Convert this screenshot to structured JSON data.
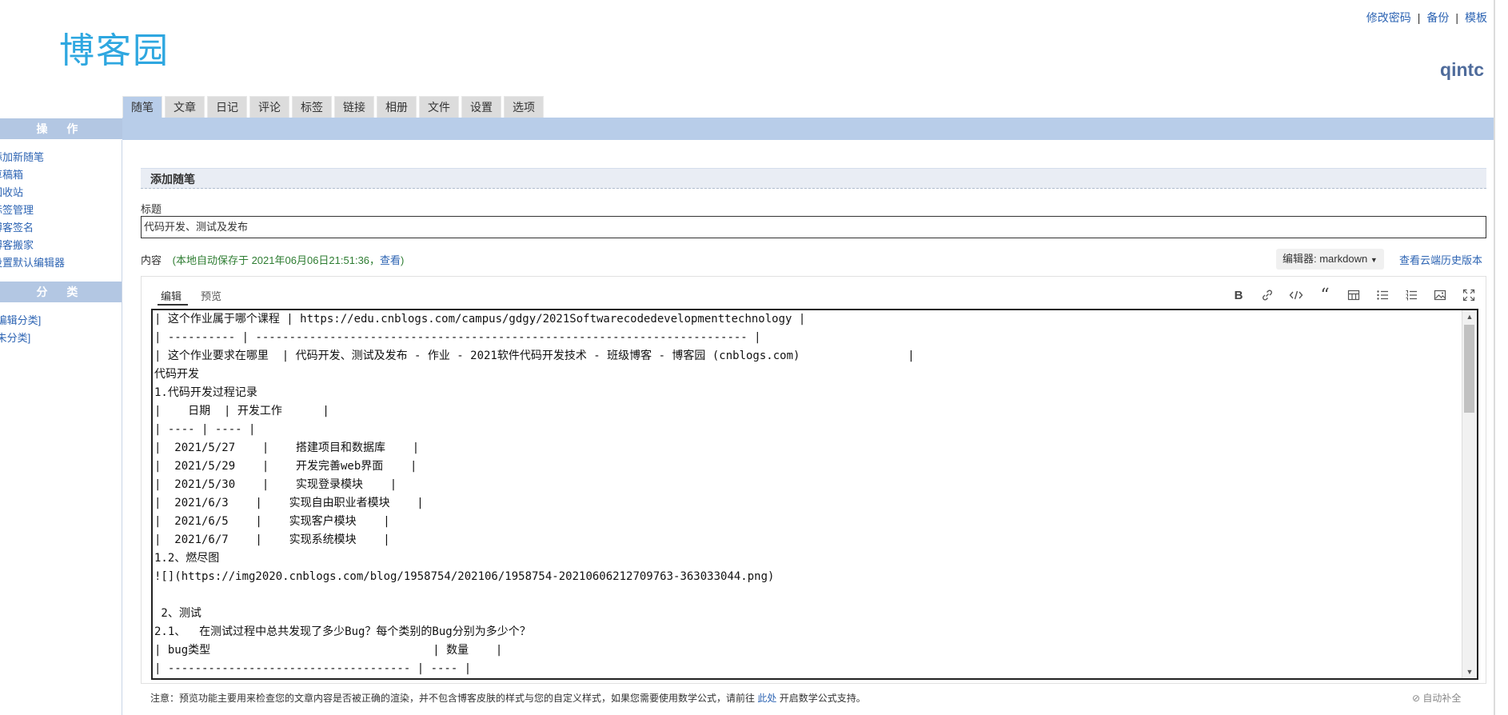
{
  "logo": {
    "text": "博客园"
  },
  "top_links": [
    "修改密码",
    "备份",
    "模板"
  ],
  "username": "qintc",
  "tabs": [
    "随笔",
    "文章",
    "日记",
    "评论",
    "标签",
    "链接",
    "相册",
    "文件",
    "设置",
    "选项"
  ],
  "sidebar": {
    "ops_title": "操 作",
    "ops_items": [
      "添加新随笔",
      "草稿箱",
      "回收站",
      "标签管理",
      "博客签名",
      "博客搬家",
      "设置默认编辑器"
    ],
    "cat_title": "分 类",
    "cat_items": [
      "[编辑分类]",
      "[未分类]"
    ]
  },
  "panel_title": "添加随笔",
  "title_field": {
    "label": "标题",
    "value": "代码开发、测试及发布"
  },
  "content": {
    "label": "内容",
    "autosave_open": "(本地自动保存于 2021年06月06日21:51:36，",
    "autosave_link": "查看",
    "autosave_close": ")",
    "editor_select": "编辑器: markdown",
    "cloud_history": "查看云端历史版本"
  },
  "editor_tabs": [
    "编辑",
    "预览"
  ],
  "toolbar_icons": [
    "bold-icon",
    "link-icon",
    "code-icon",
    "quote-icon",
    "table-icon",
    "unordered-list-icon",
    "ordered-list-icon",
    "image-icon",
    "fullscreen-icon"
  ],
  "editor_lines": [
    "| 这个作业属于哪个课程 | https://edu.cnblogs.com/campus/gdgy/2021Softwarecodedevelopmenttechnology |",
    "| ---------- | ------------------------------------------------------------------------- |",
    "| 这个作业要求在哪里  | 代码开发、测试及发布 - 作业 - 2021软件代码开发技术 - 班级博客 - 博客园 (cnblogs.com)                |",
    "代码开发",
    "1.代码开发过程记录",
    "|    日期  | 开发工作      |",
    "| ---- | ---- |",
    "|  2021/5/27    |    搭建项目和数据库    |",
    "|  2021/5/29    |    开发完善web界面    |",
    "|  2021/5/30    |    实现登录模块    |",
    "|  2021/6/3    |    实现自由职业者模块    |",
    "|  2021/6/5    |    实现客户模块    |",
    "|  2021/6/7    |    实现系统模块    |",
    "1.2、燃尽图",
    "![](https://img2020.cnblogs.com/blog/1958754/202106/1958754-20210606212709763-363033044.png)",
    "",
    " 2、测试",
    "2.1、  在测试过程中总共发现了多少Bug？每个类别的Bug分别为多少个？",
    "| bug类型                                 | 数量    |",
    "| ------------------------------------ | ---- |"
  ],
  "notice": {
    "text_before": "注意：预览功能主要用来检查您的文章内容是否被正确的渲染，并不包含博客皮肤的样式与您的自定义样式，如果您需要使用数学公式，请前往",
    "link": "此处",
    "text_after": "开启数学公式支持。"
  },
  "autocomplete": "自动补全"
}
